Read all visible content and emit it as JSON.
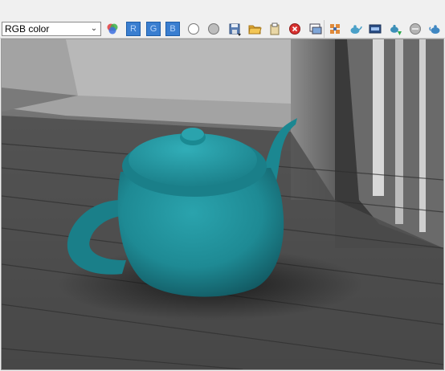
{
  "toolbar": {
    "channel_display": {
      "value": "RGB color"
    },
    "channel_buttons": [
      {
        "label": "R"
      },
      {
        "label": "G"
      },
      {
        "label": "B"
      }
    ]
  },
  "colors": {
    "teapot": "#1e8a94",
    "channel_button": "#3a7ed0"
  }
}
